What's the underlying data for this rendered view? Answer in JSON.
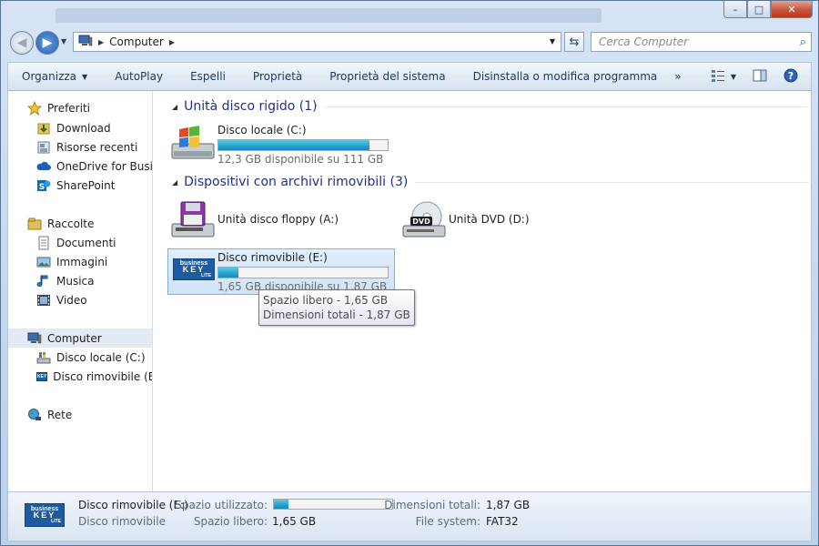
{
  "window": {
    "caption_buttons": {
      "minimize": "–",
      "maximize": "□",
      "close": "✕"
    }
  },
  "navigation": {
    "address_icon": "computer-icon",
    "address_path": [
      "Computer"
    ],
    "search_placeholder": "Cerca Computer"
  },
  "toolbar": {
    "items": [
      "Organizza",
      "AutoPlay",
      "Espelli",
      "Proprietà",
      "Proprietà del sistema",
      "Disinstalla o modifica programma"
    ],
    "more": "»"
  },
  "sidebar": {
    "favorites_header": "Preferiti",
    "favorites": [
      "Download",
      "Risorse recenti",
      "OneDrive for Business",
      "SharePoint"
    ],
    "libraries_header": "Raccolte",
    "libraries": [
      "Documenti",
      "Immagini",
      "Musica",
      "Video"
    ],
    "computer_header": "Computer",
    "computer_items": [
      "Disco locale (C:)",
      "Disco rimovibile (E:)"
    ],
    "network_header": "Rete"
  },
  "groups": {
    "hdd": {
      "title": "Unità disco rigido (1)",
      "drives": [
        {
          "name": "Disco locale (C:)",
          "space": "12,3 GB disponibile su 111 GB",
          "used_fraction": 0.89
        }
      ]
    },
    "removable": {
      "title": "Dispositivi con archivi rimovibili (3)",
      "floppy": {
        "name": "Unità disco floppy (A:)"
      },
      "dvd": {
        "name": "Unità DVD (D:)",
        "badge": "DVD"
      },
      "usb": {
        "name": "Disco rimovibile (E:)",
        "space": "1,65 GB disponibile su 1,87 GB",
        "used_fraction": 0.12
      }
    }
  },
  "tooltip": {
    "line1": "Spazio libero - 1,65 GB",
    "line2": "Dimensioni totali - 1,87 GB"
  },
  "details": {
    "name": "Disco rimovibile (E:)",
    "type": "Disco rimovibile",
    "used_label": "Spazio utilizzato:",
    "used_fraction": 0.12,
    "free_label": "Spazio libero:",
    "free_value": "1,65 GB",
    "total_label": "Dimensioni totali:",
    "total_value": "1,87 GB",
    "fs_label": "File system:",
    "fs_value": "FAT32"
  },
  "logo": {
    "line1": "business",
    "line2": "KEY",
    "line3": "LITE"
  },
  "colors": {
    "accent": "#1e3287",
    "bar_fill": "#27a4cf"
  }
}
